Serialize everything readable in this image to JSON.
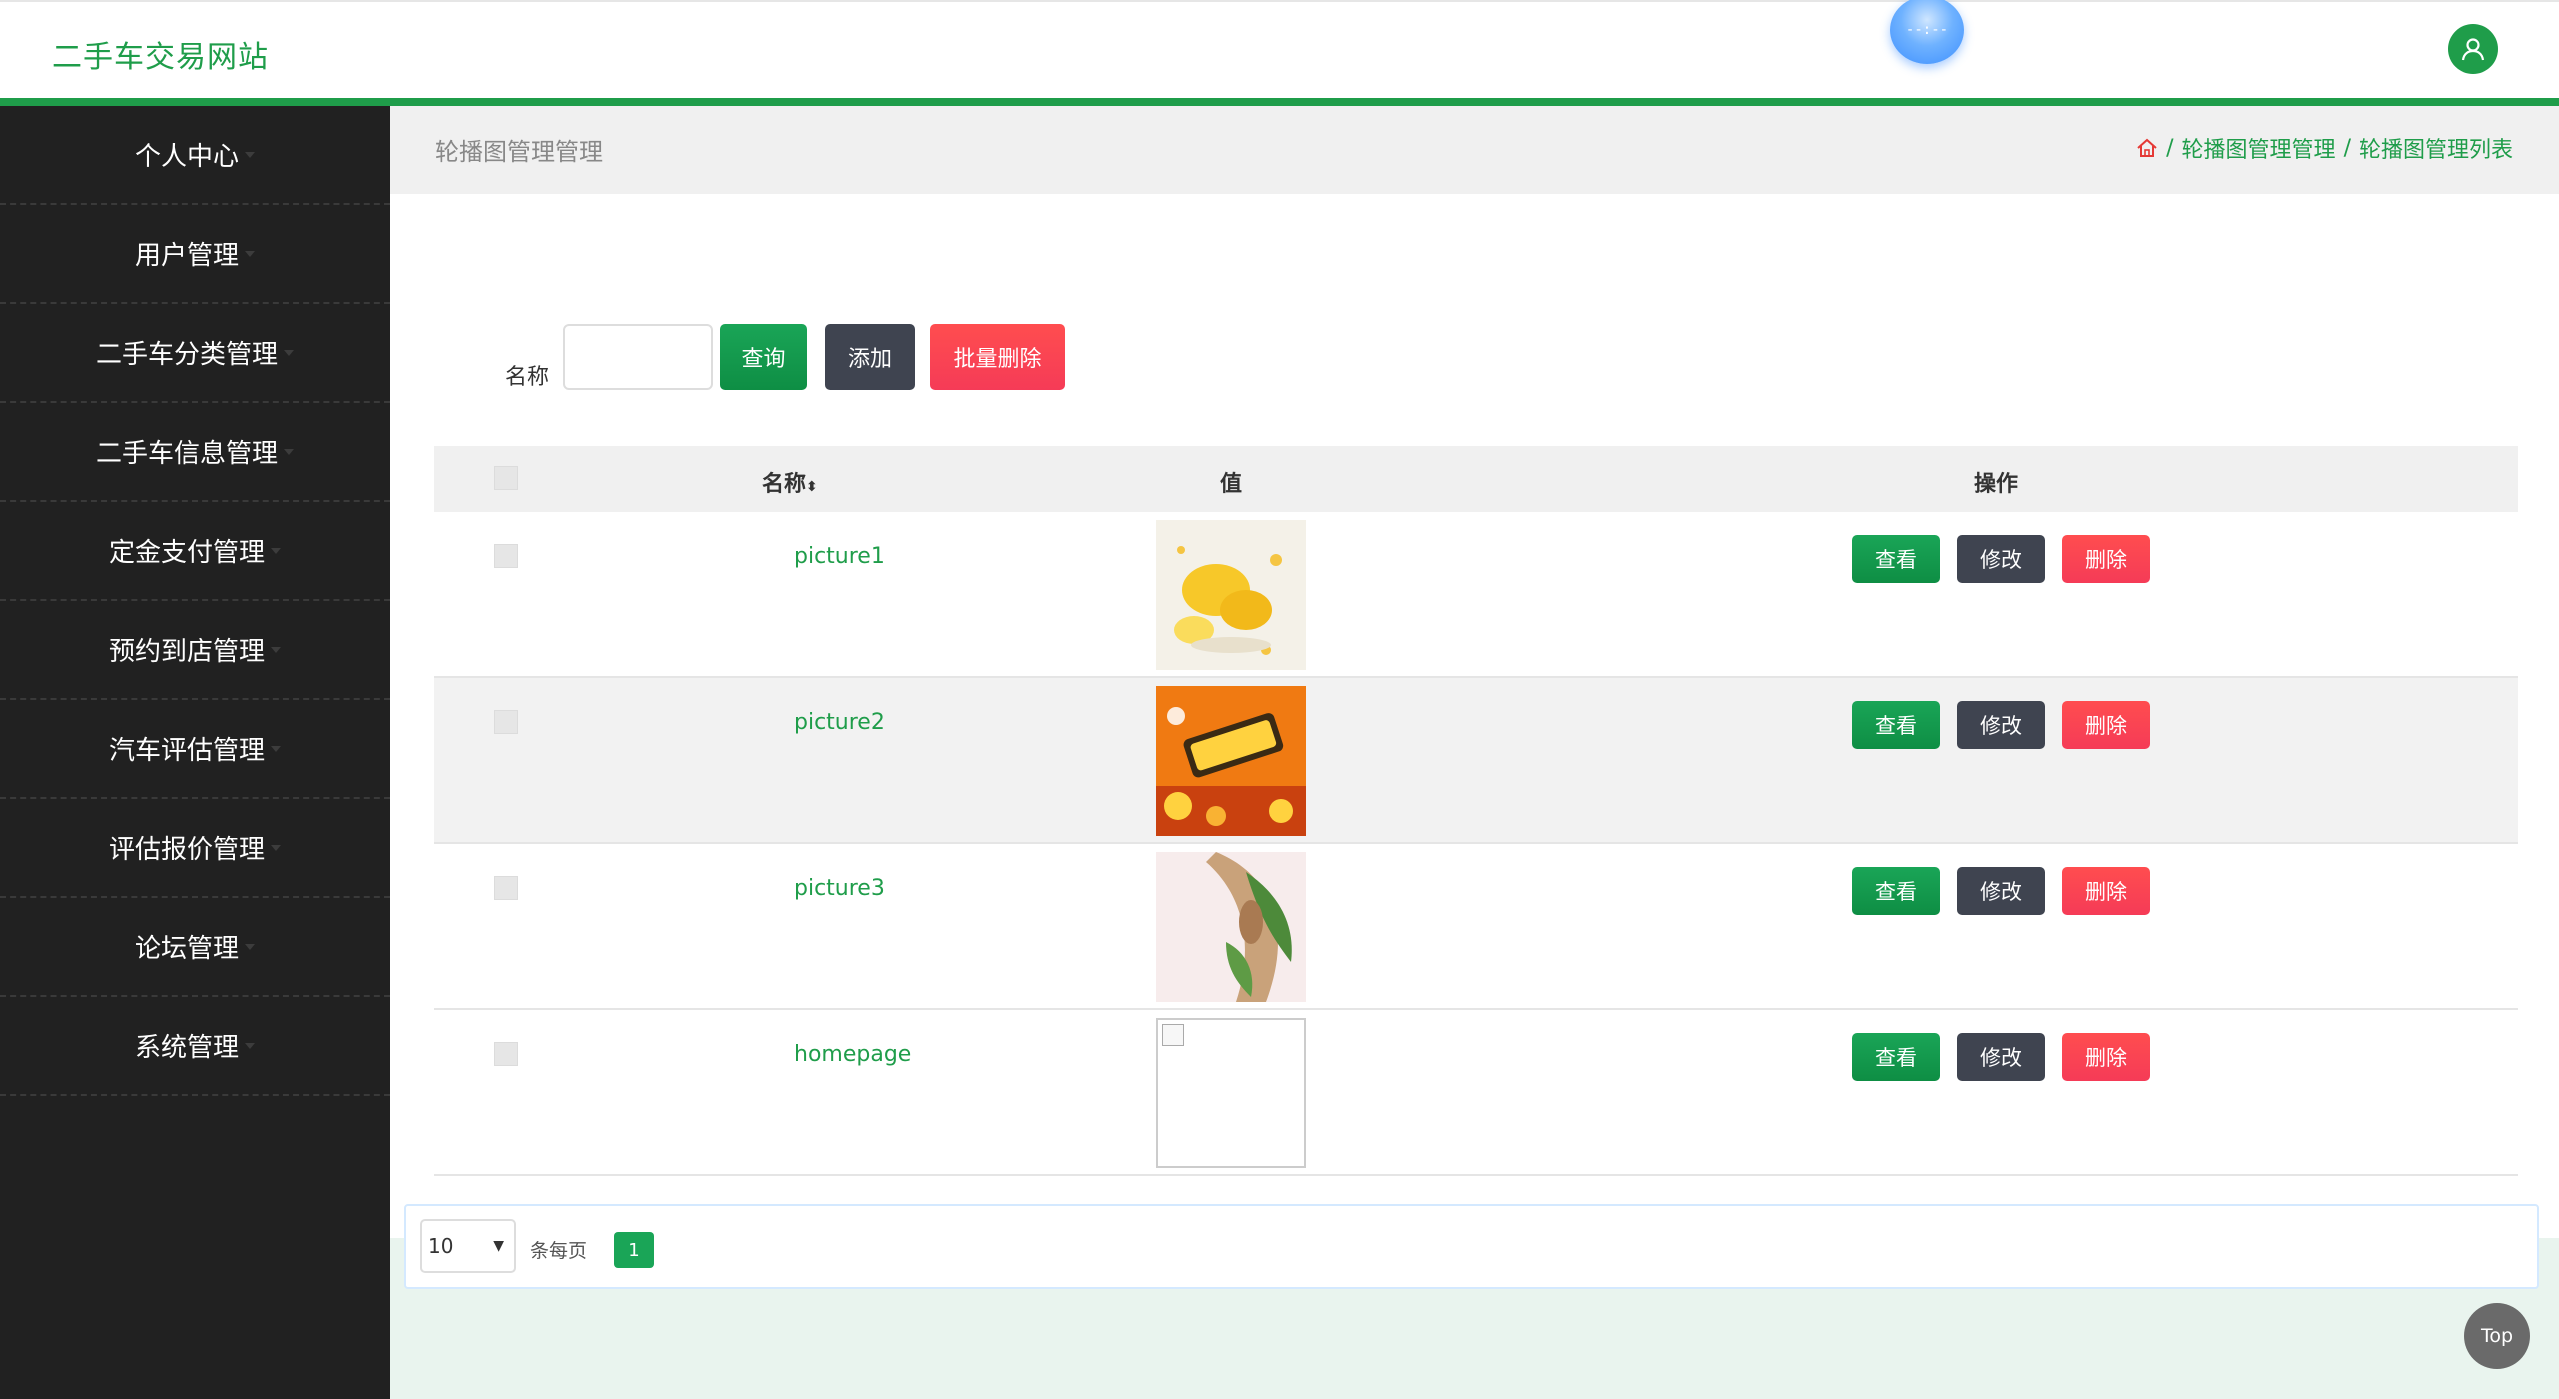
{
  "header": {
    "site_title": "二手车交易网站",
    "clock_text": "--:--"
  },
  "sidebar": {
    "items": [
      {
        "label": "个人中心"
      },
      {
        "label": "用户管理"
      },
      {
        "label": "二手车分类管理"
      },
      {
        "label": "二手车信息管理"
      },
      {
        "label": "定金支付管理"
      },
      {
        "label": "预约到店管理"
      },
      {
        "label": "汽车评估管理"
      },
      {
        "label": "评估报价管理"
      },
      {
        "label": "论坛管理"
      },
      {
        "label": "系统管理"
      }
    ]
  },
  "page": {
    "heading": "轮播图管理管理",
    "breadcrumb": [
      "轮播图管理管理",
      "轮播图管理列表"
    ],
    "breadcrumb_sep": "/"
  },
  "search": {
    "label": "名称",
    "value": "",
    "query_label": "查询",
    "add_label": "添加",
    "batch_delete_label": "批量删除"
  },
  "table": {
    "headers": {
      "name": "名称",
      "value": "值",
      "actions": "操作"
    },
    "rows": [
      {
        "name": "picture1",
        "image": "food-yellow"
      },
      {
        "name": "picture2",
        "image": "promo-orange"
      },
      {
        "name": "picture3",
        "image": "food-pink"
      },
      {
        "name": "homepage",
        "image": "broken"
      }
    ],
    "actions": {
      "view": "查看",
      "edit": "修改",
      "delete": "删除"
    }
  },
  "pagination": {
    "page_size": "10",
    "page_size_label": "条每页",
    "current_page": "1"
  },
  "back_to_top": "Top",
  "colors": {
    "brand": "#1f9d4a",
    "sidebar": "#212121",
    "danger": "#f53b57",
    "dark_button": "#3f4450"
  }
}
